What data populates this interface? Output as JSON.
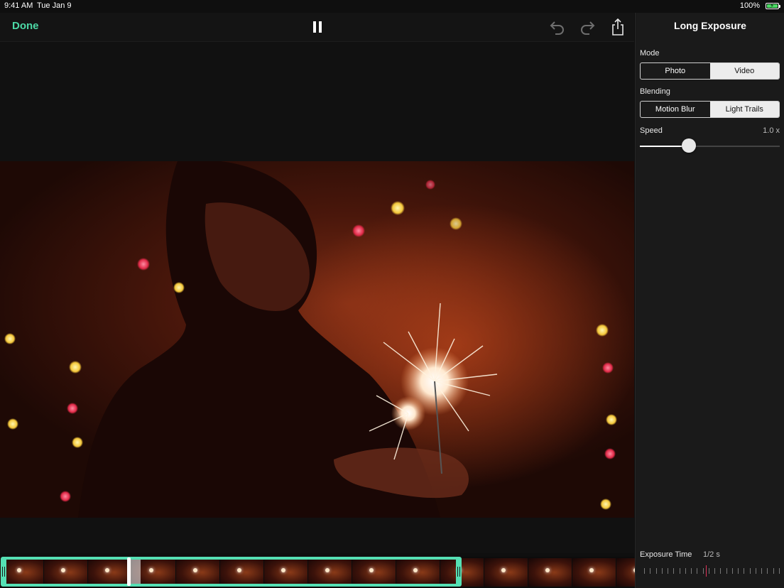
{
  "status_bar": {
    "time": "9:41 AM",
    "date": "Tue Jan 9",
    "battery_percent": "100%"
  },
  "toolbar": {
    "done_label": "Done",
    "icons": [
      "pause-icon",
      "undo-icon",
      "redo-icon",
      "share-icon"
    ]
  },
  "panel": {
    "title": "Long Exposure",
    "mode": {
      "label": "Mode",
      "options": [
        "Photo",
        "Video"
      ],
      "selected": "Video"
    },
    "blending": {
      "label": "Blending",
      "options": [
        "Motion Blur",
        "Light Trails"
      ],
      "selected": "Light Trails"
    },
    "speed": {
      "label": "Speed",
      "value_text": "1.0 x",
      "level": 0.35
    },
    "exposure": {
      "label": "Exposure Time",
      "value_text": "1/2 s",
      "level": 0.46
    }
  },
  "timeline": {
    "trim_start": 0,
    "trim_end": 0.727,
    "playhead": 0.2
  },
  "colors": {
    "accent": "#55e0b4",
    "done_text": "#4cd9a6",
    "exposure_marker": "#e0335a",
    "panel_bg": "#1a1a1a"
  }
}
